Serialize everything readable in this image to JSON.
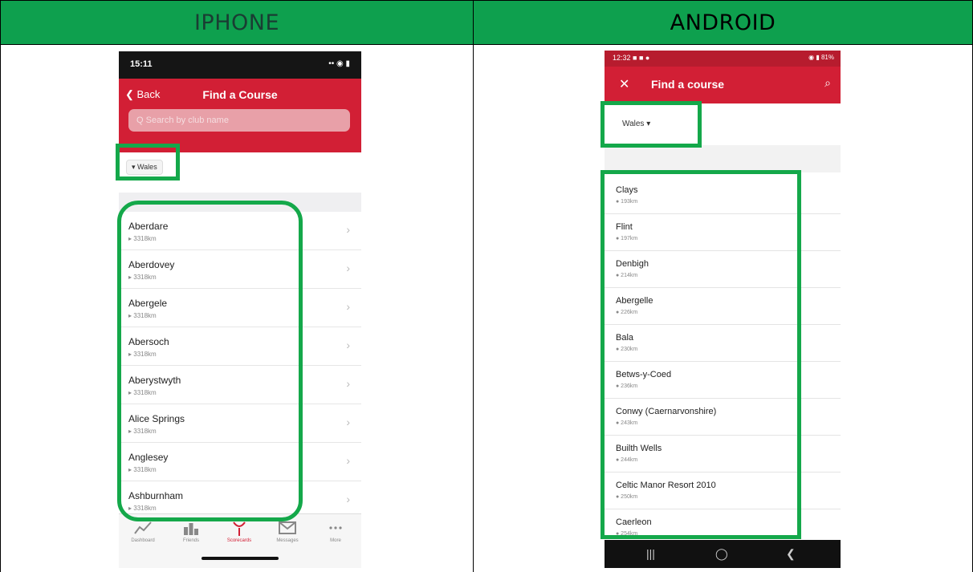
{
  "headers": {
    "left": "IPHONE",
    "right": "ANDROID"
  },
  "iphone": {
    "status_time": "15:11",
    "status_icons": "•• ◉ ▮",
    "back_label": "❮ Back",
    "title": "Find a Course",
    "search_placeholder": "Q  Search by club name",
    "filter_chip": "▾ Wales",
    "courses": [
      {
        "name": "Aberdare",
        "distance": "▸ 3318km"
      },
      {
        "name": "Aberdovey",
        "distance": "▸ 3318km"
      },
      {
        "name": "Abergele",
        "distance": "▸ 3318km"
      },
      {
        "name": "Abersoch",
        "distance": "▸ 3318km"
      },
      {
        "name": "Aberystwyth",
        "distance": "▸ 3318km"
      },
      {
        "name": "Alice Springs",
        "distance": "▸ 3318km"
      },
      {
        "name": "Anglesey",
        "distance": "▸ 3318km"
      },
      {
        "name": "Ashburnham",
        "distance": "▸ 3318km"
      }
    ],
    "tabs": [
      {
        "label": "Dashboard",
        "icon": "chart-line-icon"
      },
      {
        "label": "Friends",
        "icon": "leaderboard-icon"
      },
      {
        "label": "Scorecards",
        "icon": "golf-tee-icon"
      },
      {
        "label": "Messages",
        "icon": "envelope-icon"
      },
      {
        "label": "More",
        "icon": "more-icon"
      }
    ],
    "chevron": "›"
  },
  "android": {
    "status_time": "12:32 ■ ■ ●",
    "status_icons": "◉ ▮ 81%",
    "close": "✕",
    "title": "Find a course",
    "search_icon": "⌕",
    "filter": "Wales  ▾",
    "courses": [
      {
        "name": "Clays",
        "distance": "● 193km"
      },
      {
        "name": "Flint",
        "distance": "● 197km"
      },
      {
        "name": "Denbigh",
        "distance": "● 214km"
      },
      {
        "name": "Abergelle",
        "distance": "● 226km"
      },
      {
        "name": "Bala",
        "distance": "● 230km"
      },
      {
        "name": "Betws-y-Coed",
        "distance": "● 236km"
      },
      {
        "name": "Conwy (Caernarvonshire)",
        "distance": "● 243km"
      },
      {
        "name": "Builth Wells",
        "distance": "● 244km"
      },
      {
        "name": "Celtic Manor Resort 2010",
        "distance": "● 250km"
      },
      {
        "name": "Caerleon",
        "distance": "● 254km"
      }
    ],
    "nav": {
      "recents": "|||",
      "home": "◯",
      "back": "❮"
    }
  },
  "colors": {
    "header_green": "#0ea04e",
    "highlight_green": "#14a84a",
    "brand_red": "#d21f35"
  }
}
